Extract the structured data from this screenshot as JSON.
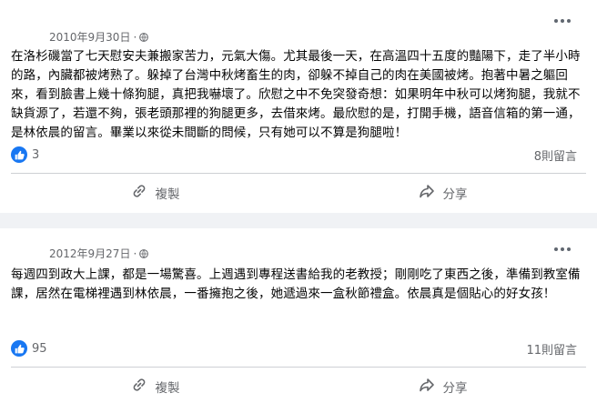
{
  "posts": [
    {
      "date": "2010年9月30日",
      "separator": "·",
      "privacy_icon": "globe-icon",
      "text": "在洛杉磯當了七天慰安夫兼搬家苦力，元氣大傷。尤其最後一天，在高溫四十五度的豔陽下，走了半小時的路，內臟都被烤熟了。躲掉了台灣中秋烤畜生的肉，卻躲不掉自己的肉在美國被烤。抱著中暑之軀回來，看到臉書上幾十條狗腿，真把我嚇壞了。欣慰之中不免突發奇想：如果明年中秋可以烤狗腿，我就不缺貨源了，若還不夠，張老頭那裡的狗腿更多，去借來烤。最欣慰的是，打開手機，語音信箱的第一通，是林依晨的留言。畢業以來從未間斷的問候，只有她可以不算是狗腿啦！",
      "likes": "3",
      "comments": "8則留言",
      "copy_label": "複製",
      "share_label": "分享"
    },
    {
      "date": "2012年9月27日",
      "separator": "·",
      "privacy_icon": "globe-icon",
      "text": "每週四到政大上課，都是一場驚喜。上週遇到專程送書給我的老教授；剛剛吃了東西之後，準備到教室備課，居然在電梯裡遇到林依晨，一番擁抱之後，她遞過來一盒秋節禮盒。依晨真是個貼心的好女孩！",
      "likes": "95",
      "comments": "11則留言",
      "copy_label": "複製",
      "share_label": "分享"
    }
  ],
  "colors": {
    "like_blue": "#1877f2",
    "muted": "#65676b",
    "background": "#f0f2f5"
  }
}
